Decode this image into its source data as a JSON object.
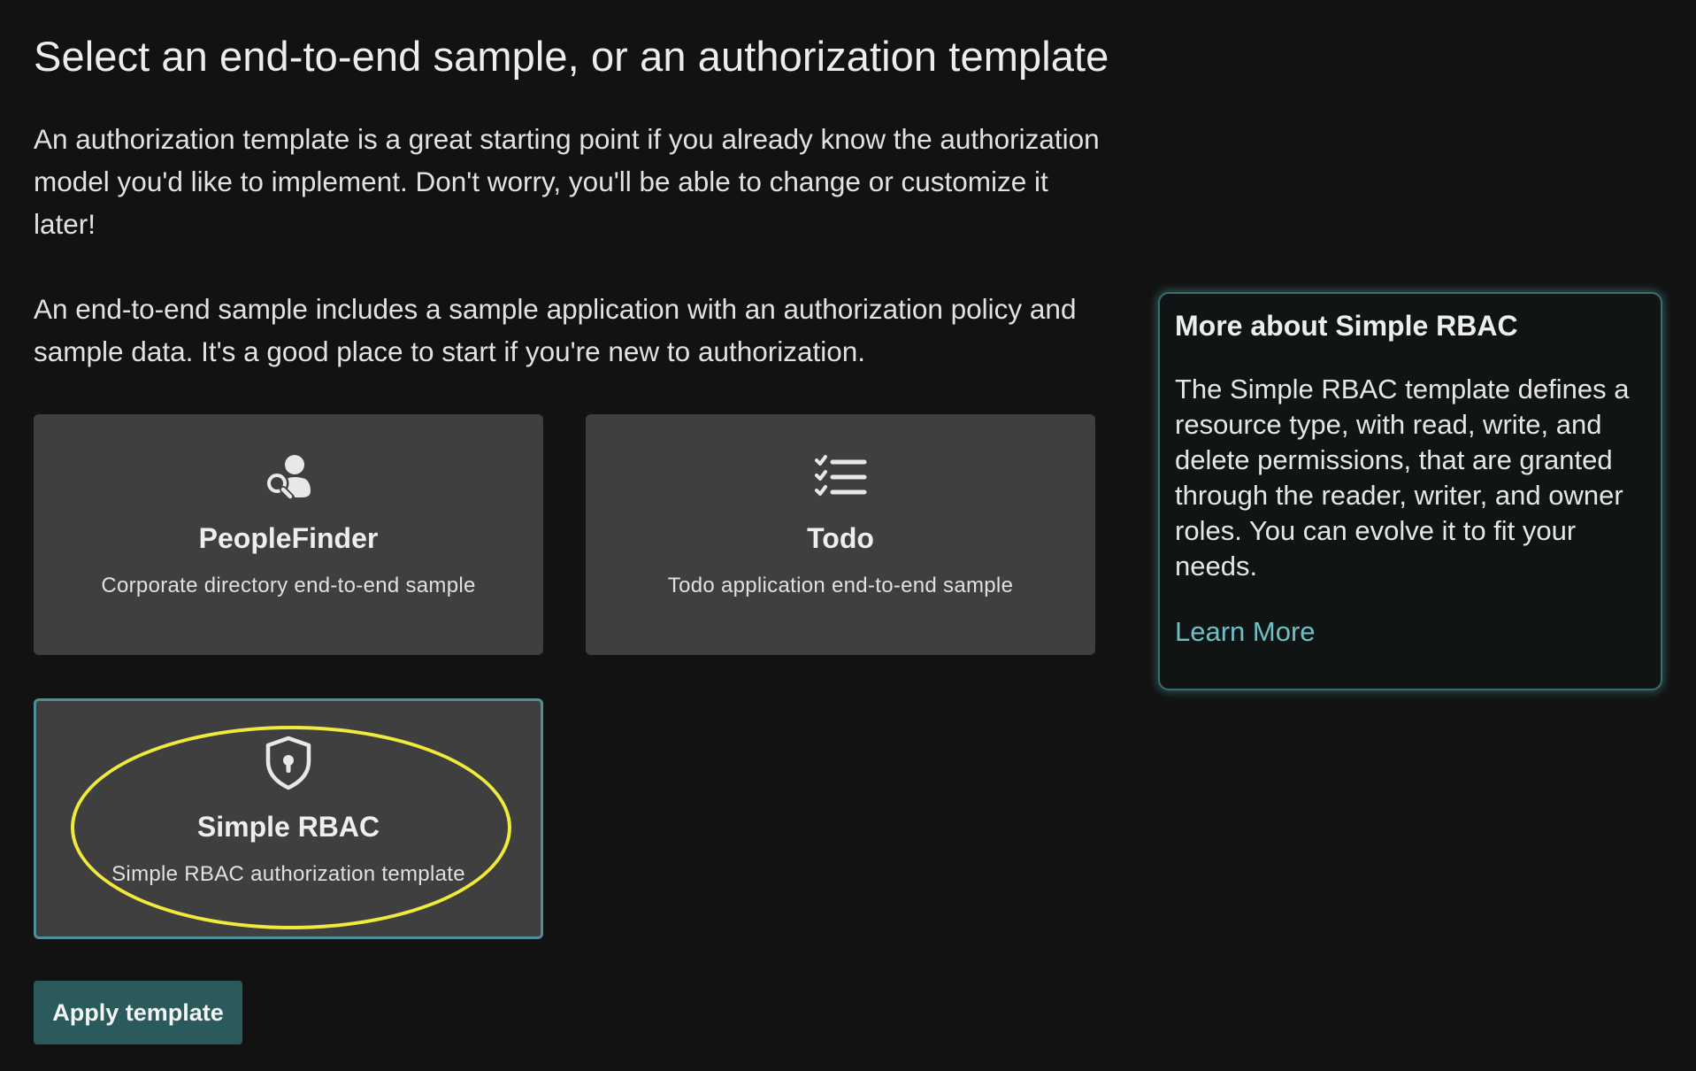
{
  "header": {
    "title": "Select an end-to-end sample, or an authorization template"
  },
  "intro": {
    "paragraph_1": "An authorization template is a great starting point if you already know the authorization model you'd like to implement. Don't worry, you'll be able to change or customize it later!",
    "paragraph_2": "An end-to-end sample includes a sample application with an authorization policy and sample data. It's a good place to start if you're new to authorization."
  },
  "cards": [
    {
      "title": "PeopleFinder",
      "description": "Corporate directory end-to-end sample",
      "icon": "people-search-icon",
      "selected": false
    },
    {
      "title": "Todo",
      "description": "Todo application end-to-end sample",
      "icon": "checklist-icon",
      "selected": false
    },
    {
      "title": "Simple RBAC",
      "description": "Simple RBAC authorization template",
      "icon": "shield-lock-icon",
      "selected": true
    }
  ],
  "actions": {
    "apply_label": "Apply template"
  },
  "info_panel": {
    "title": "More about Simple RBAC",
    "body": "The Simple RBAC template defines a resource type, with read, write, and delete permissions, that are granted through the reader, writer, and owner roles. You can evolve it to fit your needs.",
    "link_label": "Learn More"
  },
  "colors": {
    "background": "#121212",
    "card": "#3f3f3f",
    "selected_border": "#4f8f97",
    "accent_button": "#2a5a5c",
    "link": "#6fc0c4",
    "annotation_highlight": "#f0ea3c"
  }
}
